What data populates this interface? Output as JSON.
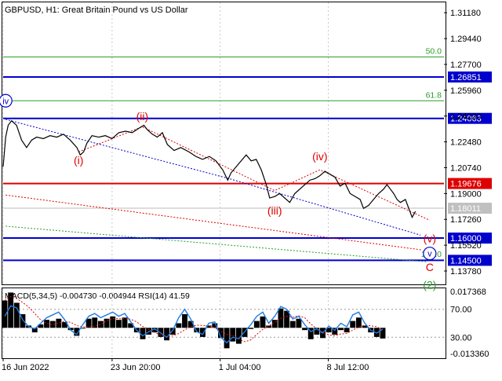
{
  "header": {
    "symbol_title": "GBPUSD, H1:  Great Britain Pound vs US Dollar"
  },
  "chart_data": [
    {
      "type": "line",
      "title": "GBPUSD, H1:  Great Britain Pound vs US Dollar",
      "ylim": [
        1.1288,
        1.3188
      ],
      "y_ticks": [
        "1.31180",
        "1.29440",
        "1.27700",
        "1.25960",
        "1.24220",
        "1.22480",
        "1.20740",
        "1.19000",
        "1.17260",
        "1.15520",
        "1.13780"
      ],
      "x_ticks": [
        {
          "label": "16 Jun 2022",
          "index": 0
        },
        {
          "label": "23 Jun 20:00",
          "index": 130
        },
        {
          "label": "1 Jul 04:00",
          "index": 259
        },
        {
          "label": "8 Jul 12:00",
          "index": 388
        }
      ],
      "price_path": [
        [
          0,
          1.208
        ],
        [
          3,
          1.228
        ],
        [
          6,
          1.236
        ],
        [
          10,
          1.239
        ],
        [
          16,
          1.236
        ],
        [
          22,
          1.226
        ],
        [
          28,
          1.221
        ],
        [
          34,
          1.226
        ],
        [
          40,
          1.228
        ],
        [
          48,
          1.227
        ],
        [
          56,
          1.229
        ],
        [
          64,
          1.228
        ],
        [
          72,
          1.23
        ],
        [
          80,
          1.226
        ],
        [
          88,
          1.221
        ],
        [
          92,
          1.216
        ],
        [
          96,
          1.218
        ],
        [
          100,
          1.224
        ],
        [
          106,
          1.229
        ],
        [
          114,
          1.228
        ],
        [
          122,
          1.229
        ],
        [
          130,
          1.227
        ],
        [
          138,
          1.231
        ],
        [
          146,
          1.232
        ],
        [
          154,
          1.231
        ],
        [
          162,
          1.234
        ],
        [
          168,
          1.236
        ],
        [
          172,
          1.233
        ],
        [
          178,
          1.23
        ],
        [
          184,
          1.228
        ],
        [
          190,
          1.231
        ],
        [
          196,
          1.223
        ],
        [
          204,
          1.219
        ],
        [
          212,
          1.221
        ],
        [
          222,
          1.218
        ],
        [
          230,
          1.215
        ],
        [
          238,
          1.213
        ],
        [
          246,
          1.215
        ],
        [
          254,
          1.212
        ],
        [
          262,
          1.206
        ],
        [
          268,
          1.199
        ],
        [
          272,
          1.204
        ],
        [
          278,
          1.208
        ],
        [
          284,
          1.212
        ],
        [
          290,
          1.216
        ],
        [
          296,
          1.212
        ],
        [
          302,
          1.213
        ],
        [
          308,
          1.206
        ],
        [
          314,
          1.196
        ],
        [
          318,
          1.187
        ],
        [
          324,
          1.188
        ],
        [
          330,
          1.19
        ],
        [
          336,
          1.187
        ],
        [
          342,
          1.184
        ],
        [
          348,
          1.19
        ],
        [
          354,
          1.193
        ],
        [
          360,
          1.196
        ],
        [
          366,
          1.199
        ],
        [
          372,
          1.2
        ],
        [
          378,
          1.202
        ],
        [
          384,
          1.205
        ],
        [
          390,
          1.203
        ],
        [
          396,
          1.201
        ],
        [
          402,
          1.195
        ],
        [
          408,
          1.197
        ],
        [
          414,
          1.19
        ],
        [
          420,
          1.188
        ],
        [
          426,
          1.186
        ],
        [
          430,
          1.18
        ],
        [
          436,
          1.182
        ],
        [
          442,
          1.186
        ],
        [
          448,
          1.19
        ],
        [
          454,
          1.193
        ],
        [
          458,
          1.196
        ],
        [
          462,
          1.193
        ],
        [
          466,
          1.19
        ],
        [
          470,
          1.186
        ],
        [
          474,
          1.184
        ],
        [
          480,
          1.186
        ],
        [
          484,
          1.18
        ],
        [
          488,
          1.174
        ],
        [
          492,
          1.178
        ]
      ],
      "last_price": "1.18011",
      "levels": [
        {
          "label": "1.26851",
          "value": 1.26851,
          "color": "#0000cc"
        },
        {
          "label": "1.24063",
          "value": 1.24063,
          "color": "#0000cc"
        },
        {
          "label": "1.19676",
          "value": 1.19676,
          "color": "#dd0000"
        },
        {
          "label": "1.16000",
          "value": 1.16,
          "color": "#0000cc"
        },
        {
          "label": "1.14500",
          "value": 1.145,
          "color": "#0000cc"
        }
      ],
      "fib_levels": [
        {
          "label": "50.0",
          "value": 1.282
        },
        {
          "label": "61.8",
          "value": 1.2525
        },
        {
          "label": "100.0",
          "value": 1.1452
        }
      ],
      "wave_labels": [
        {
          "text": "iv",
          "index": 3,
          "value": 1.2525,
          "color": "#0000cc",
          "circled": true
        },
        {
          "text": "(i)",
          "index": 90,
          "value": 1.2125,
          "color": "#dd0000"
        },
        {
          "text": "(ii)",
          "index": 166,
          "value": 1.242,
          "color": "#dd0000"
        },
        {
          "text": "(iii)",
          "index": 324,
          "value": 1.1785,
          "color": "#dd0000"
        },
        {
          "text": "(iv)",
          "index": 378,
          "value": 1.215,
          "color": "#dd0000"
        },
        {
          "text": "(v)",
          "index": 509,
          "value": 1.1598,
          "color": "#dd0000"
        },
        {
          "text": "v",
          "index": 509,
          "value": 1.1496,
          "color": "#0000cc",
          "circled": true
        },
        {
          "text": "C",
          "index": 509,
          "value": 1.1405,
          "color": "#dd0000"
        },
        {
          "text": "(2)",
          "index": 509,
          "value": 1.1285,
          "color": "#2a9d2a"
        }
      ],
      "colors": {
        "price": "#000000",
        "red_line": "#dd0000",
        "blue_line": "#0000cc",
        "fib_line": "#2a9d2a",
        "grid": "#c8c8c8"
      }
    },
    {
      "type": "line",
      "title": "MACD(5,34,5) -0.004730 -0.004944 RSI(14) 41.59",
      "y_ticks": [
        "0.017368",
        "70.00",
        "30.00",
        "-0.013360"
      ],
      "series": [
        {
          "name": "MACD",
          "values": [
            0.012,
            0.0155,
            0.011,
            0.006,
            0.001,
            -0.002,
            0.0015,
            0.0035,
            0.003,
            0.004,
            0.0025,
            -0.001,
            -0.0035,
            0.0,
            0.004,
            0.0045,
            0.003,
            0.004,
            0.005,
            0.0035,
            0.0045,
            0.002,
            -0.002,
            -0.005,
            -0.003,
            -0.002,
            -0.004,
            -0.0055,
            -0.003,
            0.002,
            0.006,
            0.003,
            -0.002,
            -0.004,
            0.001,
            0.002,
            -0.0045,
            -0.009,
            -0.006,
            -0.007,
            -0.004,
            -0.0005,
            0.003,
            0.005,
            0.001,
            0.0035,
            0.0085,
            0.0075,
            0.003,
            0.004,
            -0.001,
            -0.005,
            -0.003,
            -0.0045,
            -0.002,
            -0.003,
            -0.001,
            -0.002,
            0.003,
            0.0045,
            0.001,
            -0.002,
            -0.004,
            -0.0047
          ]
        },
        {
          "name": "RSI",
          "values": [
            60,
            75,
            72,
            55,
            45,
            42,
            50,
            58,
            62,
            66,
            55,
            40,
            34,
            48,
            60,
            64,
            58,
            62,
            66,
            60,
            64,
            52,
            40,
            32,
            38,
            42,
            36,
            30,
            40,
            58,
            70,
            56,
            38,
            34,
            50,
            52,
            30,
            22,
            30,
            28,
            38,
            48,
            60,
            66,
            50,
            60,
            74,
            70,
            56,
            60,
            48,
            38,
            42,
            36,
            46,
            40,
            50,
            45,
            62,
            66,
            50,
            40,
            36,
            41.59
          ]
        }
      ]
    }
  ]
}
